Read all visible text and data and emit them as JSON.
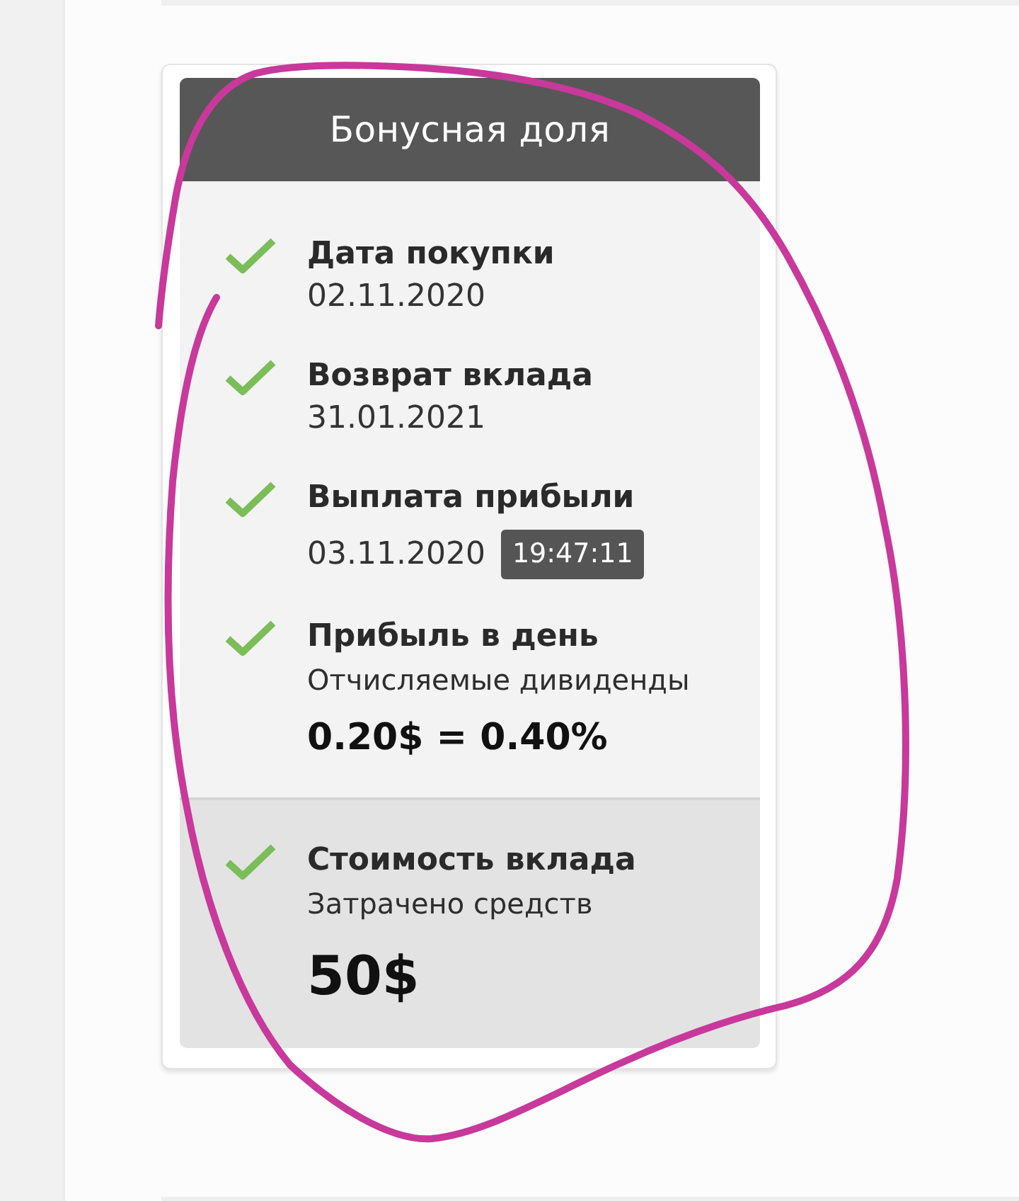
{
  "card": {
    "title": "Бонусная доля",
    "items": [
      {
        "kind": "date",
        "checked": true,
        "title": "Дата покупки",
        "value": "02.11.2020"
      },
      {
        "kind": "date",
        "checked": true,
        "title": "Возврат вклада",
        "value": "31.01.2021"
      },
      {
        "kind": "date_time",
        "checked": true,
        "title": "Выплата прибыли",
        "value": "03.11.2020",
        "time": "19:47:11"
      },
      {
        "kind": "amount",
        "checked": true,
        "title": "Прибыль в день",
        "subtitle": "Отчисляемые дивиденды",
        "value": "0.20$ = 0.40%"
      }
    ],
    "footer": {
      "kind": "total",
      "checked": true,
      "title": "Стоимость вклада",
      "subtitle": "Затрачено средств",
      "value": "50$"
    }
  }
}
